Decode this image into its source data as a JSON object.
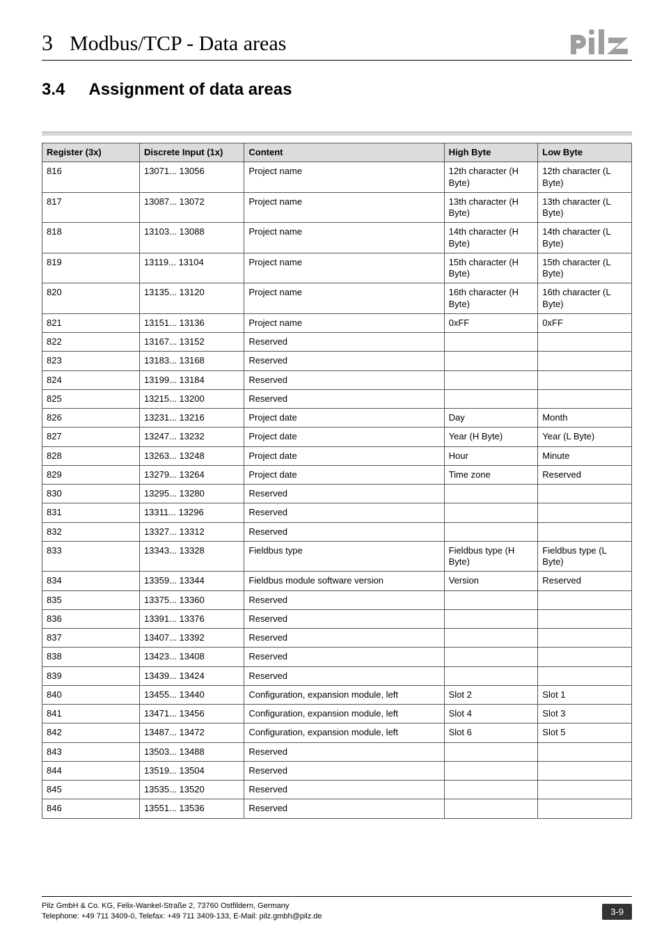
{
  "header": {
    "chapter_number": "3",
    "chapter_title": "Modbus/TCP - Data areas"
  },
  "section": {
    "number": "3.4",
    "title": "Assignment of data areas"
  },
  "table": {
    "headers": {
      "register": "Register (3x)",
      "discrete_input": "Discrete Input (1x)",
      "content": "Content",
      "high_byte": "High Byte",
      "low_byte": "Low Byte"
    },
    "rows": [
      {
        "register": "816",
        "discrete_input": "13071... 13056",
        "content": "Project name",
        "high_byte": "12th character (H Byte)",
        "low_byte": "12th character (L Byte)"
      },
      {
        "register": "817",
        "discrete_input": "13087... 13072",
        "content": "Project name",
        "high_byte": "13th character (H Byte)",
        "low_byte": "13th character (L Byte)"
      },
      {
        "register": "818",
        "discrete_input": "13103... 13088",
        "content": "Project name",
        "high_byte": "14th character (H Byte)",
        "low_byte": "14th character (L Byte)"
      },
      {
        "register": "819",
        "discrete_input": "13119... 13104",
        "content": "Project name",
        "high_byte": "15th character (H Byte)",
        "low_byte": "15th character (L Byte)"
      },
      {
        "register": "820",
        "discrete_input": "13135... 13120",
        "content": "Project name",
        "high_byte": "16th character (H Byte)",
        "low_byte": "16th character (L Byte)"
      },
      {
        "register": "821",
        "discrete_input": "13151... 13136",
        "content": "Project name",
        "high_byte": "0xFF",
        "low_byte": "0xFF"
      },
      {
        "register": "822",
        "discrete_input": "13167... 13152",
        "content": "Reserved",
        "high_byte": "",
        "low_byte": ""
      },
      {
        "register": "823",
        "discrete_input": "13183... 13168",
        "content": "Reserved",
        "high_byte": "",
        "low_byte": ""
      },
      {
        "register": "824",
        "discrete_input": "13199... 13184",
        "content": "Reserved",
        "high_byte": "",
        "low_byte": ""
      },
      {
        "register": "825",
        "discrete_input": "13215... 13200",
        "content": "Reserved",
        "high_byte": "",
        "low_byte": ""
      },
      {
        "register": "826",
        "discrete_input": "13231... 13216",
        "content": "Project date",
        "high_byte": "Day",
        "low_byte": "Month"
      },
      {
        "register": "827",
        "discrete_input": "13247... 13232",
        "content": "Project date",
        "high_byte": "Year (H Byte)",
        "low_byte": "Year (L Byte)"
      },
      {
        "register": "828",
        "discrete_input": "13263... 13248",
        "content": "Project date",
        "high_byte": "Hour",
        "low_byte": "Minute"
      },
      {
        "register": "829",
        "discrete_input": "13279... 13264",
        "content": "Project date",
        "high_byte": "Time zone",
        "low_byte": "Reserved"
      },
      {
        "register": "830",
        "discrete_input": "13295... 13280",
        "content": "Reserved",
        "high_byte": "",
        "low_byte": ""
      },
      {
        "register": "831",
        "discrete_input": "13311... 13296",
        "content": "Reserved",
        "high_byte": "",
        "low_byte": ""
      },
      {
        "register": "832",
        "discrete_input": "13327... 13312",
        "content": "Reserved",
        "high_byte": "",
        "low_byte": ""
      },
      {
        "register": "833",
        "discrete_input": "13343... 13328",
        "content": "Fieldbus type",
        "high_byte": "Fieldbus type (H Byte)",
        "low_byte": "Fieldbus type (L Byte)"
      },
      {
        "register": "834",
        "discrete_input": "13359... 13344",
        "content": "Fieldbus module software version",
        "high_byte": "Version",
        "low_byte": "Reserved"
      },
      {
        "register": "835",
        "discrete_input": "13375... 13360",
        "content": "Reserved",
        "high_byte": "",
        "low_byte": ""
      },
      {
        "register": "836",
        "discrete_input": "13391... 13376",
        "content": "Reserved",
        "high_byte": "",
        "low_byte": ""
      },
      {
        "register": "837",
        "discrete_input": "13407... 13392",
        "content": "Reserved",
        "high_byte": "",
        "low_byte": ""
      },
      {
        "register": "838",
        "discrete_input": "13423... 13408",
        "content": "Reserved",
        "high_byte": "",
        "low_byte": ""
      },
      {
        "register": "839",
        "discrete_input": "13439... 13424",
        "content": "Reserved",
        "high_byte": "",
        "low_byte": ""
      },
      {
        "register": "840",
        "discrete_input": "13455... 13440",
        "content": "Configuration, expansion module, left",
        "high_byte": "Slot 2",
        "low_byte": "Slot 1"
      },
      {
        "register": "841",
        "discrete_input": "13471... 13456",
        "content": "Configuration, expansion module, left",
        "high_byte": "Slot 4",
        "low_byte": "Slot 3"
      },
      {
        "register": "842",
        "discrete_input": "13487... 13472",
        "content": "Configuration, expansion module, left",
        "high_byte": "Slot 6",
        "low_byte": "Slot 5"
      },
      {
        "register": "843",
        "discrete_input": "13503... 13488",
        "content": "Reserved",
        "high_byte": "",
        "low_byte": ""
      },
      {
        "register": "844",
        "discrete_input": "13519... 13504",
        "content": "Reserved",
        "high_byte": "",
        "low_byte": ""
      },
      {
        "register": "845",
        "discrete_input": "13535... 13520",
        "content": "Reserved",
        "high_byte": "",
        "low_byte": ""
      },
      {
        "register": "846",
        "discrete_input": "13551... 13536",
        "content": "Reserved",
        "high_byte": "",
        "low_byte": ""
      }
    ]
  },
  "footer": {
    "line1": "Pilz GmbH & Co. KG, Felix-Wankel-Straße 2, 73760 Ostfildern, Germany",
    "line2": "Telephone: +49 711 3409-0, Telefax: +49 711 3409-133, E-Mail: pilz.gmbh@pilz.de",
    "page": "3-9"
  }
}
